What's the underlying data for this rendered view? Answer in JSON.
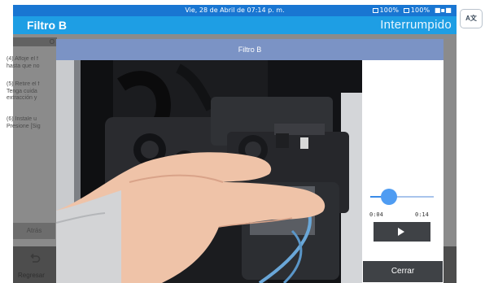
{
  "status_bar": {
    "datetime": "Vie, 28 de Abril de 07:14 p. m.",
    "battery_1": "100%",
    "battery_2": "100%"
  },
  "title_bar": {
    "title": "Filtro B",
    "run_status": "Interrumpido"
  },
  "language_button": {
    "label": "A文"
  },
  "background_screen": {
    "header": "O",
    "steps": [
      {
        "lines": [
          "(4) Afloje el f",
          "hasta que no"
        ]
      },
      {
        "lines": [
          "(5) Retire el f",
          "Tenga cuida",
          "extracción y"
        ]
      },
      {
        "lines": [
          "(6) Instale u",
          "Presione [Sig"
        ]
      }
    ],
    "back_label": "Atrás",
    "return_label": "Regresar"
  },
  "modal": {
    "title": "Filtro B",
    "video": {
      "subject": "hand removing filter from instrument",
      "progress": 0.29
    },
    "time_current": "0:04",
    "time_total": "0:14",
    "play_icon": "play-icon",
    "close_label": "Cerrar"
  },
  "colors": {
    "status_bar": "#1976d2",
    "title_bar": "#1e9ee4",
    "modal_header": "#7b93c5",
    "slider_accent": "#4f9cf2",
    "dark_button": "#3f4246",
    "dim_overlay": "#8b8b8b"
  }
}
